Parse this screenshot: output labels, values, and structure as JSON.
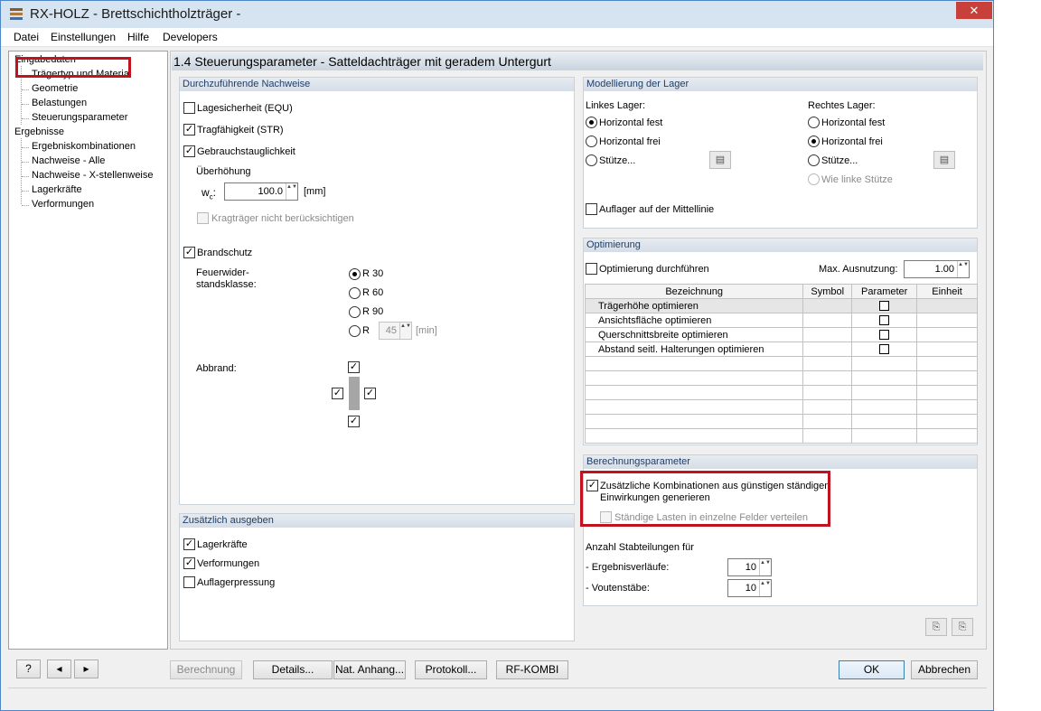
{
  "window": {
    "title": "RX-HOLZ - Brettschichtholzträger -",
    "close_glyph": "✕"
  },
  "menu": [
    "Datei",
    "Einstellungen",
    "Hilfe",
    "Developers"
  ],
  "tree": {
    "root1": "Eingabedaten",
    "children1": [
      "Trägertyp und Material",
      "Geometrie",
      "Belastungen",
      "Steuerungsparameter"
    ],
    "root2": "Ergebnisse",
    "children2": [
      "Ergebniskombinationen",
      "Nachweise - Alle",
      "Nachweise - X-stellenweise",
      "Lagerkräfte",
      "Verformungen"
    ],
    "selected": "Steuerungsparameter"
  },
  "main": {
    "header": "1.4 Steuerungsparameter  -  Satteldachträger mit geradem Untergurt"
  },
  "nachweise": {
    "header": "Durchzuführende Nachweise",
    "equ": "Lagesicherheit (EQU)",
    "str": "Tragfähigkeit (STR)",
    "gebrauch": "Gebrauchstauglichkeit",
    "ueberhoehung": "Überhöhung",
    "wc_label": "w",
    "wc_sub": "c",
    "wc_colon": ":",
    "wc_value": "100.0",
    "wc_unit": "[mm]",
    "kragtraeger": "Kragträger nicht berücksichtigen",
    "brandschutz": "Brandschutz",
    "feuer_line1": "Feuerwider-",
    "feuer_line2": "standsklasse:",
    "r30": "R 30",
    "r60": "R 60",
    "r90": "R 90",
    "r": "R",
    "r_value": "45",
    "r_unit": "[min]",
    "abbrand": "Abbrand:"
  },
  "zusaetzlich": {
    "header": "Zusätzlich ausgeben",
    "lagerkraefte": "Lagerkräfte",
    "verformungen": "Verformungen",
    "auflagerpressung": "Auflagerpressung"
  },
  "lager": {
    "header": "Modellierung der Lager",
    "links": "Linkes Lager:",
    "rechts": "Rechtes Lager:",
    "horizontal_fest": "Horizontal fest",
    "horizontal_frei": "Horizontal frei",
    "stuetze": "Stütze...",
    "wie_linke": "Wie linke Stütze",
    "mittellinie": "Auflager auf der Mittellinie"
  },
  "optimierung": {
    "header": "Optimierung",
    "durchfuehren": "Optimierung durchführen",
    "max_label": "Max. Ausnutzung:",
    "max_value": "1.00",
    "columns": [
      "Bezeichnung",
      "Symbol",
      "Parameter",
      "Einheit"
    ],
    "rows": [
      "Trägerhöhe optimieren",
      "Ansichtsfläche optimieren",
      "Querschnittsbreite optimieren",
      "Abstand seitl. Halterungen optimieren"
    ]
  },
  "berechnung": {
    "header": "Berechnungsparameter",
    "zus_line1": "Zusätzliche Kombinationen aus günstigen ständigen",
    "zus_line2": "Einwirkungen generieren",
    "staendige": "Ständige Lasten in einzelne Felder verteilen",
    "anzahl": "Anzahl Stabteilungen für",
    "ergebnis_label": "- Ergebnisverläufe:",
    "ergebnis_value": "10",
    "vouten_label": "- Voutenstäbe:",
    "vouten_value": "10"
  },
  "buttons": {
    "berechnung": "Berechnung",
    "details": "Details...",
    "anhang": "Nat. Anhang...",
    "protokoll": "Protokoll...",
    "kombi": "RF-KOMBI",
    "ok": "OK",
    "abbrechen": "Abbrechen",
    "help_glyph": "?"
  },
  "colors": {
    "accent_red": "#c0131f",
    "title_bg": "#d6e3f1",
    "group_header_text": "#1e3e68"
  },
  "check_glyph": "✓",
  "arrow_glyph": "▲▼"
}
